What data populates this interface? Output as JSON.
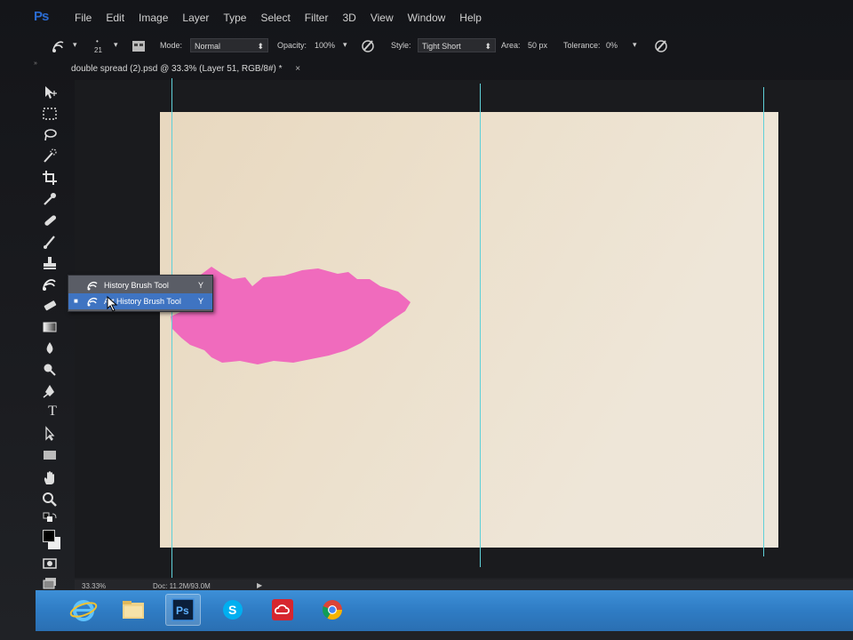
{
  "app": {
    "logo": "Ps"
  },
  "menu": [
    "File",
    "Edit",
    "Image",
    "Layer",
    "Type",
    "Select",
    "Filter",
    "3D",
    "View",
    "Window",
    "Help"
  ],
  "options": {
    "brush_size": "21",
    "mode_label": "Mode:",
    "mode_value": "Normal",
    "opacity_label": "Opacity:",
    "opacity_value": "100%",
    "style_label": "Style:",
    "style_value": "Tight Short",
    "area_label": "Area:",
    "area_value": "50 px",
    "tolerance_label": "Tolerance:",
    "tolerance_value": "0%"
  },
  "document": {
    "tab_title": "double spread (2).psd @ 33.3% (Layer 51, RGB/8#) *",
    "close": "×"
  },
  "flyout": {
    "items": [
      {
        "label": "History Brush Tool",
        "shortcut": "Y",
        "selected": false
      },
      {
        "label": "Art History Brush Tool",
        "shortcut": "Y",
        "selected": true
      }
    ],
    "bullet": "■"
  },
  "statusbar": {
    "zoom": "33.33%",
    "doc": "Doc: 11.2M/93.0M",
    "arrow": "▶"
  },
  "taskbar": {
    "icons": [
      "internet-explorer-icon",
      "file-explorer-icon",
      "photoshop-icon",
      "skype-icon",
      "creative-cloud-icon",
      "chrome-icon"
    ]
  },
  "colors": {
    "paint": "#f06bbd",
    "guide": "#5fd0d8",
    "taskbar": "#2f7cc4",
    "flyout_selected": "#3f74c2"
  }
}
